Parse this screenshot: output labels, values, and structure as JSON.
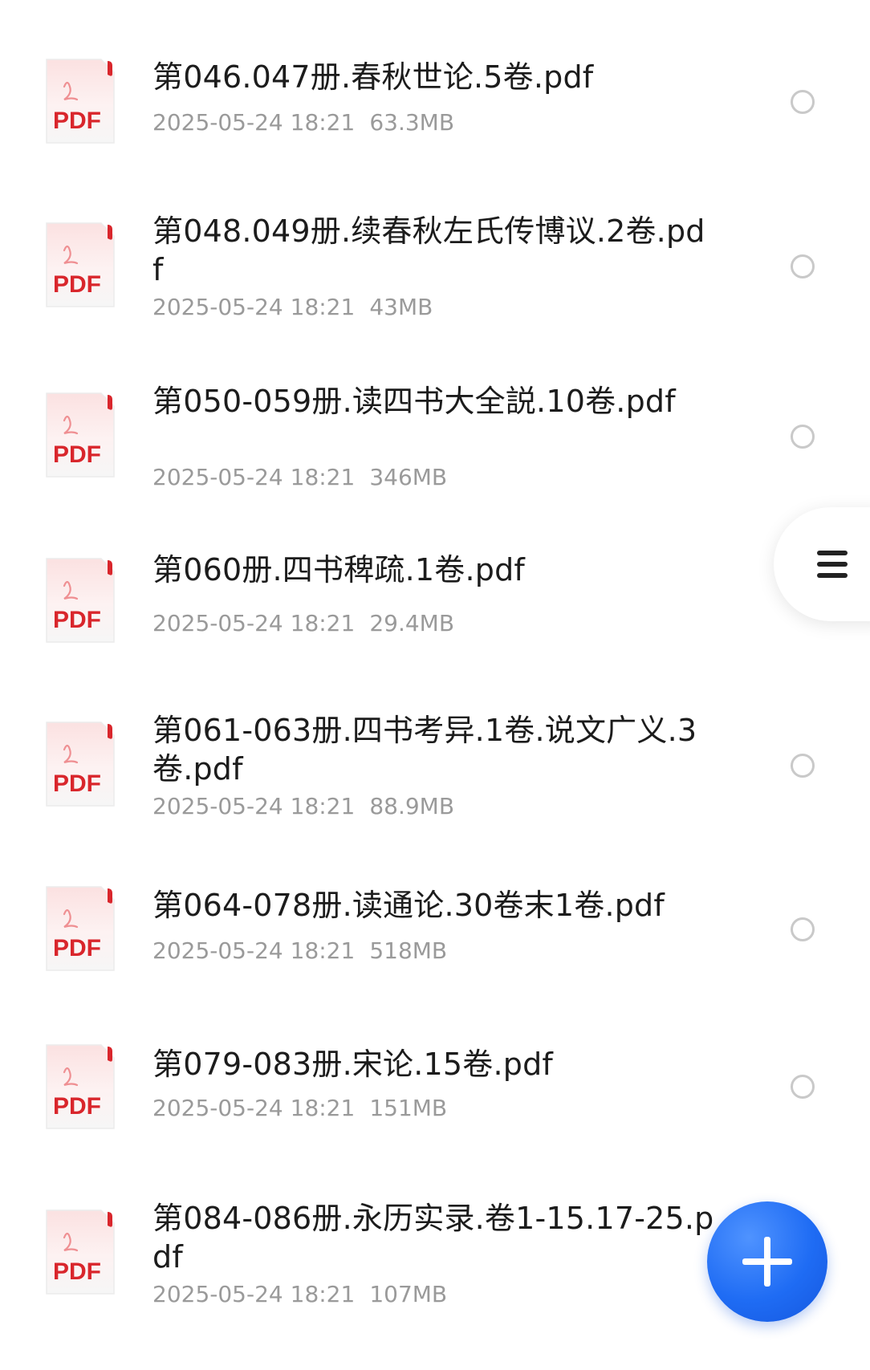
{
  "files": [
    {
      "name": "第046.047册.春秋世论.5卷.pdf",
      "date": "2025-05-24 18:21",
      "size": "63.3MB",
      "icon": "pdf-file-icon",
      "icon_label": "PDF"
    },
    {
      "name": "第048.049册.续春秋左氏传博议.2卷.pdf",
      "date": "2025-05-24 18:21",
      "size": "43MB",
      "icon": "pdf-file-icon",
      "icon_label": "PDF"
    },
    {
      "name": "第050-059册.读四书大全説.10卷.pdf",
      "date": "2025-05-24 18:21",
      "size": "346MB",
      "icon": "pdf-file-icon",
      "icon_label": "PDF"
    },
    {
      "name": "第060册.四书稗疏.1卷.pdf",
      "date": "2025-05-24 18:21",
      "size": "29.4MB",
      "icon": "pdf-file-icon",
      "icon_label": "PDF"
    },
    {
      "name": "第061-063册.四书考异.1卷.说文广义.3卷.pdf",
      "date": "2025-05-24 18:21",
      "size": "88.9MB",
      "icon": "pdf-file-icon",
      "icon_label": "PDF"
    },
    {
      "name": "第064-078册.读通论.30卷末1卷.pdf",
      "date": "2025-05-24 18:21",
      "size": "518MB",
      "icon": "pdf-file-icon",
      "icon_label": "PDF"
    },
    {
      "name": "第079-083册.宋论.15卷.pdf",
      "date": "2025-05-24 18:21",
      "size": "151MB",
      "icon": "pdf-file-icon",
      "icon_label": "PDF"
    },
    {
      "name": "第084-086册.永历实录.卷1-15.17-25.pdf",
      "date": "2025-05-24 18:21",
      "size": "107MB",
      "icon": "pdf-file-icon",
      "icon_label": "PDF"
    }
  ],
  "side_menu": {
    "icon": "menu-icon"
  },
  "fab": {
    "icon": "plus-icon"
  },
  "colors": {
    "pdf_red": "#d9262c",
    "meta_gray": "#9a9a9a",
    "fab_blue": "#1f6cf4"
  }
}
